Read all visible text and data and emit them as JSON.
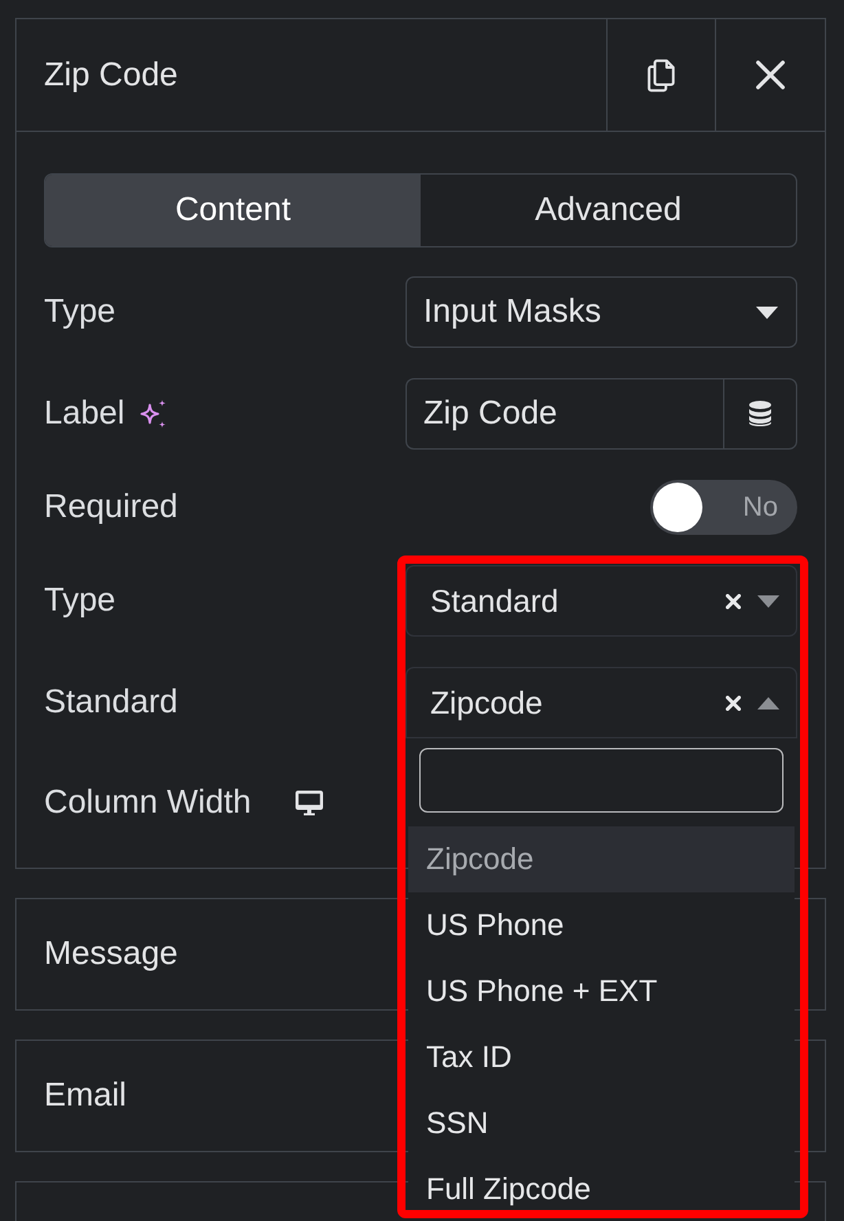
{
  "panel": {
    "title": "Zip Code"
  },
  "tabs": [
    {
      "label": "Content",
      "selected": true
    },
    {
      "label": "Advanced",
      "selected": false
    }
  ],
  "fields": [
    {
      "kind": "select",
      "label": "Type",
      "value": "Input Masks",
      "highlighted": false
    },
    {
      "kind": "text",
      "label": "Label",
      "value": "Zip Code",
      "highlighted": false
    },
    {
      "kind": "toggle",
      "label": "Required",
      "on": false,
      "state_text": "No",
      "highlighted": false
    },
    {
      "kind": "clearable-select",
      "label": "Type",
      "value": "Standard",
      "expanded": false,
      "highlighted": true
    },
    {
      "kind": "clearable-select",
      "label": "Standard",
      "value": "Zipcode",
      "expanded": true,
      "highlighted": true,
      "options": [
        {
          "label": "Zipcode",
          "selected": true
        },
        {
          "label": "US Phone",
          "selected": false
        },
        {
          "label": "US Phone + EXT",
          "selected": false
        },
        {
          "label": "Tax ID",
          "selected": false
        },
        {
          "label": "SSN",
          "selected": false
        },
        {
          "label": "Full Zipcode",
          "selected": false
        }
      ]
    },
    {
      "kind": "responsive",
      "label": "Column Width",
      "highlighted": false
    }
  ],
  "sections": [
    {
      "title": "Message"
    },
    {
      "title": "Email"
    }
  ]
}
